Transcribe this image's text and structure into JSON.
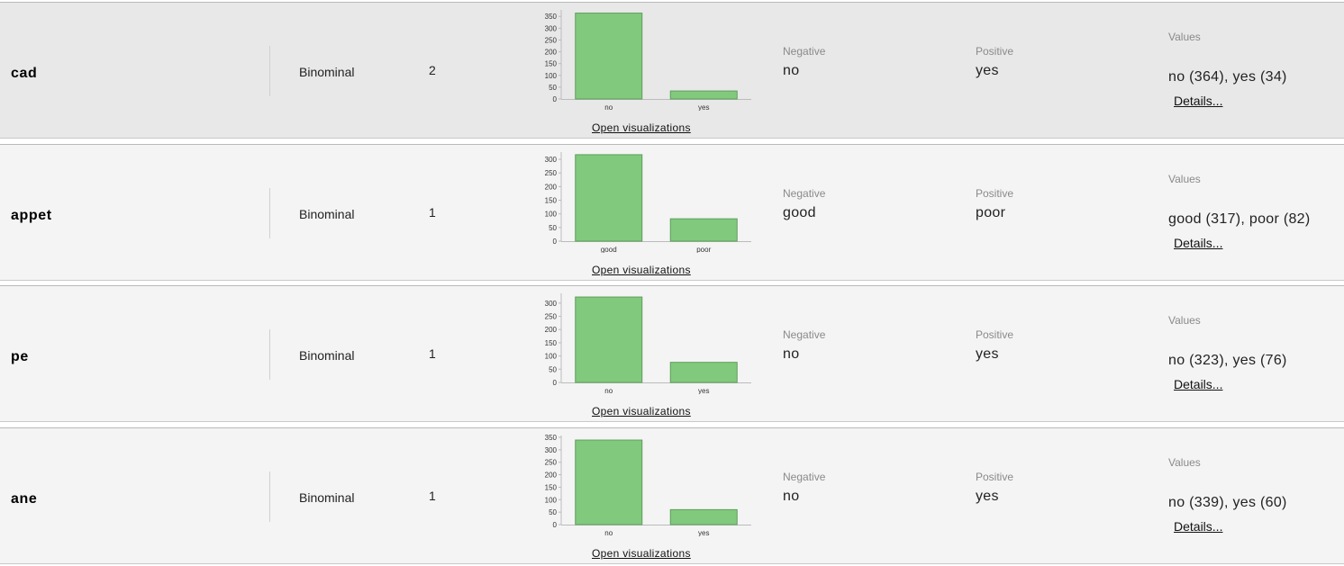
{
  "labels": {
    "negative": "Negative",
    "positive": "Positive",
    "values": "Values",
    "open_visualizations": "Open visualizations",
    "details": "Details..."
  },
  "colors": {
    "bar_fill": "#80c97d",
    "bar_stroke": "#5f9e5c",
    "selected_row_bg": "#e8e8e8",
    "row_bg": "#f4f4f4"
  },
  "rows": [
    {
      "name": "cad",
      "type": "Binominal",
      "missing": "2",
      "negative": "no",
      "positive": "yes",
      "values": "no (364), yes (34)",
      "selected": true,
      "chart_data": {
        "type": "bar",
        "categories": [
          "no",
          "yes"
        ],
        "values": [
          364,
          34
        ],
        "yticks": [
          0,
          50,
          100,
          150,
          200,
          250,
          300,
          350
        ],
        "ylim": [
          0,
          370
        ]
      }
    },
    {
      "name": "appet",
      "type": "Binominal",
      "missing": "1",
      "negative": "good",
      "positive": "poor",
      "values": "good (317), poor (82)",
      "selected": false,
      "chart_data": {
        "type": "bar",
        "categories": [
          "good",
          "poor"
        ],
        "values": [
          317,
          82
        ],
        "yticks": [
          0,
          50,
          100,
          150,
          200,
          250,
          300
        ],
        "ylim": [
          0,
          320
        ]
      }
    },
    {
      "name": "pe",
      "type": "Binominal",
      "missing": "1",
      "negative": "no",
      "positive": "yes",
      "values": "no (323), yes (76)",
      "selected": false,
      "chart_data": {
        "type": "bar",
        "categories": [
          "no",
          "yes"
        ],
        "values": [
          323,
          76
        ],
        "yticks": [
          0,
          50,
          100,
          150,
          200,
          250,
          300
        ],
        "ylim": [
          0,
          330
        ]
      }
    },
    {
      "name": "ane",
      "type": "Binominal",
      "missing": "1",
      "negative": "no",
      "positive": "yes",
      "values": "no (339), yes (60)",
      "selected": false,
      "chart_data": {
        "type": "bar",
        "categories": [
          "no",
          "yes"
        ],
        "values": [
          339,
          60
        ],
        "yticks": [
          0,
          50,
          100,
          150,
          200,
          250,
          300,
          350
        ],
        "ylim": [
          0,
          350
        ]
      }
    }
  ]
}
